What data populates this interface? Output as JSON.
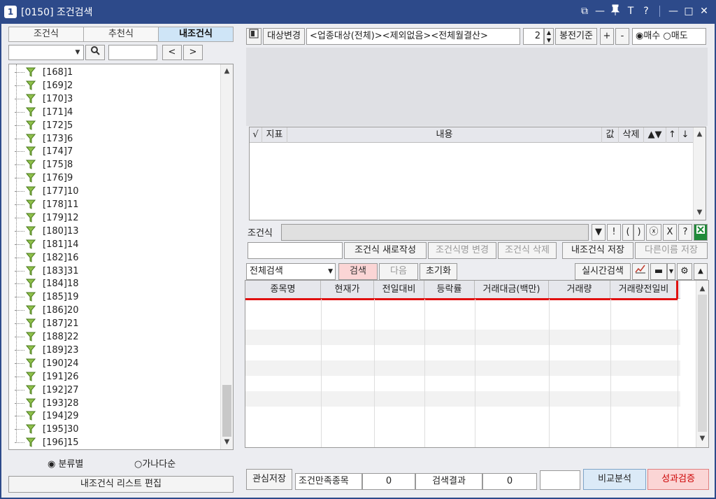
{
  "window": {
    "number_badge": "1",
    "title": "[0150] 조건검색",
    "controls": [
      "⧉",
      "—",
      "📌",
      "T",
      "?",
      "—",
      "□",
      "✕"
    ]
  },
  "left": {
    "tabs": [
      "조건식",
      "추천식",
      "내조건식"
    ],
    "active_tab": 2,
    "nav_prev": "<",
    "nav_next": ">",
    "tree_items": [
      "[168]1",
      "[169]2",
      "[170]3",
      "[171]4",
      "[172]5",
      "[173]6",
      "[174]7",
      "[175]8",
      "[176]9",
      "[177]10",
      "[178]11",
      "[179]12",
      "[180]13",
      "[181]14",
      "[182]16",
      "[183]31",
      "[184]18",
      "[185]19",
      "[186]20",
      "[187]21",
      "[188]22",
      "[189]23",
      "[190]24",
      "[191]26",
      "[192]27",
      "[193]28",
      "[194]29",
      "[195]30",
      "[196]15"
    ],
    "radio_category": "분류별",
    "radio_alpha": "가나다순",
    "edit_list_label": "내조건식 리스트 편집"
  },
  "right": {
    "target_change_label": "대상변경",
    "target_text": "<업종대상(전체)><제외없음><전체월결산>",
    "candle_count": "2",
    "candle_basis_label": "봉전기준",
    "plus": "+",
    "minus": "-",
    "buy_label": "매수",
    "sell_label": "매도",
    "cond_headers": [
      "√",
      "지표",
      "내용",
      "값",
      "삭제",
      "▲▼",
      "↑",
      "↓"
    ],
    "cond_label": "조건식",
    "cond_tools": [
      "▼",
      "!",
      "(",
      ")",
      "ⓧ",
      "X",
      "?"
    ],
    "new_cond_label": "조건식 새로작성",
    "rename_label": "조건식명 변경",
    "delete_label": "조건식 삭제",
    "save_label": "내조건식 저장",
    "save_as_label": "다른이름 저장",
    "search_scope": "전체검색",
    "search_label": "검색",
    "next_label": "다음",
    "reset_label": "초기화",
    "realtime_label": "실시간검색",
    "result_headers": [
      "종목명",
      "현재가",
      "전일대비",
      "등락률",
      "거래대금(백만)",
      "거래량",
      "거래량전일비"
    ],
    "interest_save_label": "관심저장",
    "matched_label": "조건만족종목",
    "matched_count": "0",
    "result_label": "검색결과",
    "result_count": "0",
    "compare_label": "비교분석",
    "verify_label": "성과검증"
  }
}
